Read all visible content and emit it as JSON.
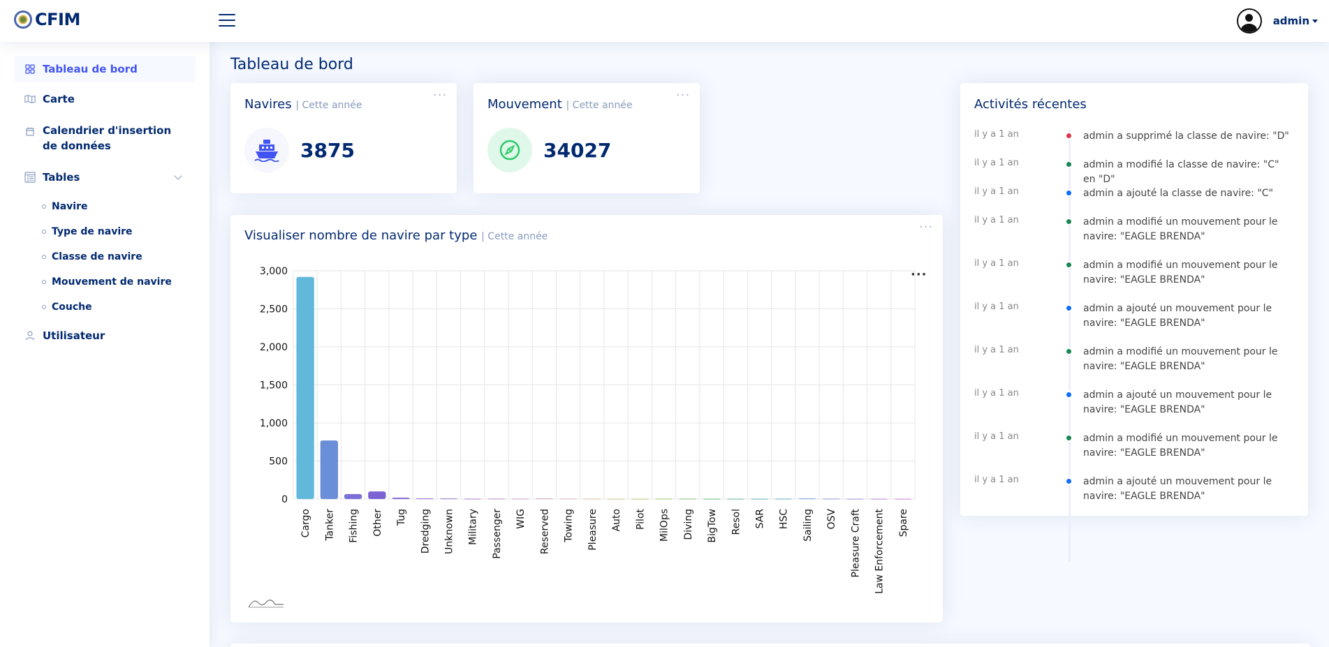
{
  "app": {
    "logo_text": "CFIM"
  },
  "header": {
    "user": "admin"
  },
  "sidebar": {
    "items": [
      {
        "label": "Tableau de bord",
        "icon": "grid-icon"
      },
      {
        "label": "Carte",
        "icon": "map-icon"
      },
      {
        "label": "Calendrier d'insertion de données",
        "icon": "calendar-icon"
      },
      {
        "label": "Tables",
        "icon": "layout-text-window-icon"
      },
      {
        "label": "Utilisateur",
        "icon": "person-icon"
      }
    ],
    "subitems": [
      "Navire",
      "Type de navire",
      "Classe de navire",
      "Mouvement de navire",
      "Couche"
    ]
  },
  "page": {
    "title": "Tableau de bord"
  },
  "cards": {
    "navires": {
      "title": "Navires",
      "period": "| Cette année",
      "value": "3875"
    },
    "mouvement": {
      "title": "Mouvement",
      "period": "| Cette année",
      "value": "34027"
    },
    "chart": {
      "title": "Visualiser nombre de navire par type",
      "period": "| Cette année"
    }
  },
  "activity": {
    "title": "Activités récentes",
    "items": [
      {
        "time": "il y a 1 an",
        "color": "#dc3545",
        "text": "admin a supprimé la classe de navire: \"D\""
      },
      {
        "time": "il y a 1 an",
        "color": "#198754",
        "text": "admin a modifié la classe de navire: \"C\" en \"D\""
      },
      {
        "time": "il y a 1 an",
        "color": "#0d6efd",
        "text": "admin a ajouté la classe de navire: \"C\""
      },
      {
        "time": "il y a 1 an",
        "color": "#198754",
        "text": "admin a modifié un mouvement pour le navire: \"EAGLE BRENDA\""
      },
      {
        "time": "il y a 1 an",
        "color": "#198754",
        "text": "admin a modifié un mouvement pour le navire: \"EAGLE BRENDA\""
      },
      {
        "time": "il y a 1 an",
        "color": "#0d6efd",
        "text": "admin a ajouté un mouvement pour le navire: \"EAGLE BRENDA\""
      },
      {
        "time": "il y a 1 an",
        "color": "#198754",
        "text": "admin a modifié un mouvement pour le navire: \"EAGLE BRENDA\""
      },
      {
        "time": "il y a 1 an",
        "color": "#0d6efd",
        "text": "admin a ajouté un mouvement pour le navire: \"EAGLE BRENDA\""
      },
      {
        "time": "il y a 1 an",
        "color": "#198754",
        "text": "admin a modifié un mouvement pour le navire: \"EAGLE BRENDA\""
      },
      {
        "time": "il y a 1 an",
        "color": "#0d6efd",
        "text": "admin a ajouté un mouvement pour le navire: \"EAGLE BRENDA\""
      }
    ]
  },
  "chart_data": {
    "type": "bar",
    "categories": [
      "Cargo",
      "Tanker",
      "Fishing",
      "Other",
      "Tug",
      "Dredging",
      "Unknown",
      "Military",
      "Passenger",
      "WIG",
      "Reserved",
      "Towing",
      "Pleasure",
      "Auto",
      "Pilot",
      "MilOps",
      "Diving",
      "BigTow",
      "Resol",
      "SAR",
      "HSC",
      "Sailing",
      "OSV",
      "Pleasure Craft",
      "Law Enforcement",
      "Spare"
    ],
    "values": [
      2920,
      770,
      65,
      100,
      18,
      8,
      8,
      5,
      6,
      5,
      8,
      6,
      5,
      4,
      4,
      5,
      5,
      4,
      4,
      4,
      5,
      8,
      6,
      4,
      4,
      4
    ],
    "colors": [
      "#62b8da",
      "#6a8ed8",
      "#7a6fd6",
      "#7b63d3",
      "#8a6ad0",
      "#8f6bd0",
      "#9a74cf",
      "#a77dcc",
      "#b78acb",
      "#c99bc8",
      "#d7a4c0",
      "#dcb0b7",
      "#d8bd9f",
      "#ccc58a",
      "#b5c67c",
      "#9ac474",
      "#7dc076",
      "#6abd84",
      "#5fb79a",
      "#5eb1b3",
      "#66aac9",
      "#78a1dc",
      "#8c97e0",
      "#a18de0",
      "#b786dc",
      "#cc80d5"
    ],
    "yticks": [
      "3,000",
      "2,500",
      "2,000",
      "1,500",
      "1,000",
      "500",
      "0"
    ],
    "ylim": [
      0,
      3000
    ],
    "grid": true
  }
}
